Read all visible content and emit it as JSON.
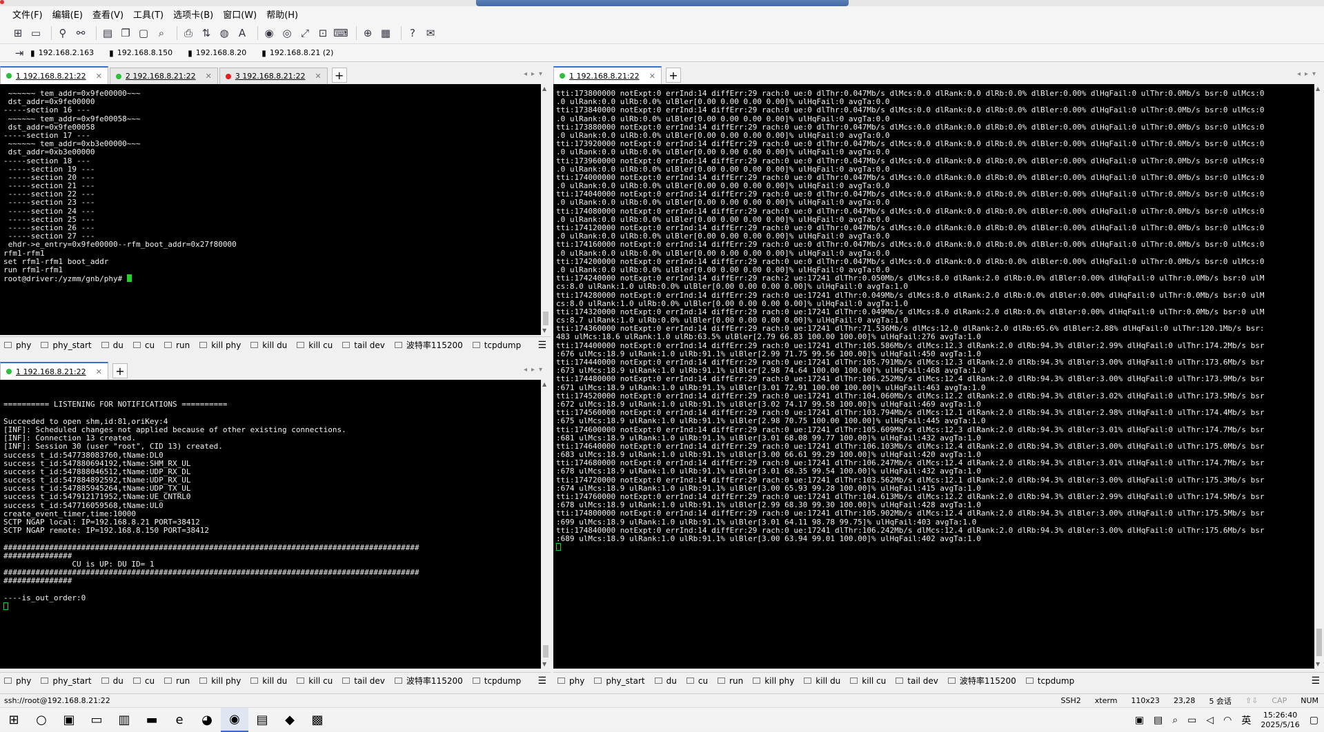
{
  "menu": [
    "文件(F)",
    "编辑(E)",
    "查看(V)",
    "工具(T)",
    "选项卡(B)",
    "窗口(W)",
    "帮助(H)"
  ],
  "bookmarks": [
    "192.168.2.163",
    "192.168.8.150",
    "192.168.8.20",
    "192.168.8.21 (2)"
  ],
  "panes": {
    "top_left": {
      "tabs": [
        {
          "label": "1 192.168.8.21:22",
          "status": "#2bbf3a",
          "active": true
        },
        {
          "label": "2 192.168.8.21:22",
          "status": "#2bbf3a",
          "active": false
        },
        {
          "label": "3 192.168.8.21:22",
          "status": "#e02020",
          "active": false
        }
      ],
      "lines": [
        " ~~~~~~ tem_addr=0x9fe00000~~~",
        " dst_addr=0x9fe00000",
        "-----section 16 ---",
        " ~~~~~~ tem_addr=0x9fe00058~~~",
        " dst_addr=0x9fe00058",
        "-----section 17 ---",
        " ~~~~~~ tem_addr=0xb3e00000~~~",
        " dst_addr=0xb3e00000",
        "-----section 18 ---",
        " -----section 19 ---",
        " -----section 20 ---",
        " -----section 21 ---",
        " -----section 22 ---",
        " -----section 23 ---",
        " -----section 24 ---",
        " -----section 25 ---",
        " -----section 26 ---",
        " -----section 27 ---",
        " ehdr->e_entry=0x9fe00000--rfm_boot_addr=0x27f80000",
        "rfm1-rfm1",
        "set rfm1-rfm1 boot_addr",
        "run rfm1-rfm1"
      ],
      "prompt": "root@driver:/yzmm/gnb/phy# "
    },
    "bottom_left": {
      "tabs": [
        {
          "label": "1 192.168.8.21:22",
          "status": "#2bbf3a",
          "active": true
        }
      ],
      "lines": [
        "",
        "",
        "========== LISTENING FOR NOTIFICATIONS ==========",
        "",
        "Succeeded to open shm,id:81,oriKey:4",
        "[INF]: Scheduled changes not applied because of other existing connections.",
        "[INF]: Connection 13 created.",
        "[INF]: Session 30 (user \"root\", CID 13) created.",
        "success t_id:547738083760,tName:DL0",
        "success t_id:547880694192,tName:SHM_RX_UL",
        "success t_id:547888046512,tName:UDP_RX_DL",
        "success t_id:547884892592,tName:UDP_RX_UL",
        "success t_id:547885945264,tName:UDP_TX_UL",
        "success t_id:547912171952,tName:UE_CNTRL0",
        "success t_id:547716059568,tName:UL0",
        "create_event_timer,time:10000",
        "SCTP NGAP local: IP=192.168.8.21 PORT=38412",
        "SCTP NGAP remote: IP=192.168.8.150 PORT=38412",
        "",
        "###########################################################################################",
        "###############",
        "               CU is UP: DU ID= 1",
        "###########################################################################################",
        "###############",
        "",
        "----is_out_order:0"
      ]
    },
    "right": {
      "tabs": [
        {
          "label": "1 192.168.8.21:22",
          "status": "#2bbf3a",
          "active": true
        }
      ],
      "lines": [
        "tti:173800000 notExpt:0 errInd:14 diffErr:29 rach:0 ue:0 dlThr:0.047Mb/s dlMcs:0.0 dlRank:0.0 dlRb:0.0% dlBler:0.00% dlHqFail:0 ulThr:0.0Mb/s bsr:0 ulMcs:0",
        ".0 ulRank:0.0 ulRb:0.0% ulBler[0.00 0.00 0.00 0.00]% ulHqFail:0 avgTa:0.0",
        "tti:173840000 notExpt:0 errInd:14 diffErr:29 rach:0 ue:0 dlThr:0.047Mb/s dlMcs:0.0 dlRank:0.0 dlRb:0.0% dlBler:0.00% dlHqFail:0 ulThr:0.0Mb/s bsr:0 ulMcs:0",
        ".0 ulRank:0.0 ulRb:0.0% ulBler[0.00 0.00 0.00 0.00]% ulHqFail:0 avgTa:0.0",
        "tti:173880000 notExpt:0 errInd:14 diffErr:29 rach:0 ue:0 dlThr:0.047Mb/s dlMcs:0.0 dlRank:0.0 dlRb:0.0% dlBler:0.00% dlHqFail:0 ulThr:0.0Mb/s bsr:0 ulMcs:0",
        ".0 ulRank:0.0 ulRb:0.0% ulBler[0.00 0.00 0.00 0.00]% ulHqFail:0 avgTa:0.0",
        "tti:173920000 notExpt:0 errInd:14 diffErr:29 rach:0 ue:0 dlThr:0.047Mb/s dlMcs:0.0 dlRank:0.0 dlRb:0.0% dlBler:0.00% dlHqFail:0 ulThr:0.0Mb/s bsr:0 ulMcs:0",
        ".0 ulRank:0.0 ulRb:0.0% ulBler[0.00 0.00 0.00 0.00]% ulHqFail:0 avgTa:0.0",
        "tti:173960000 notExpt:0 errInd:14 diffErr:29 rach:0 ue:0 dlThr:0.047Mb/s dlMcs:0.0 dlRank:0.0 dlRb:0.0% dlBler:0.00% dlHqFail:0 ulThr:0.0Mb/s bsr:0 ulMcs:0",
        ".0 ulRank:0.0 ulRb:0.0% ulBler[0.00 0.00 0.00 0.00]% ulHqFail:0 avgTa:0.0",
        "tti:174000000 notExpt:0 errInd:14 diffErr:29 rach:0 ue:0 dlThr:0.047Mb/s dlMcs:0.0 dlRank:0.0 dlRb:0.0% dlBler:0.00% dlHqFail:0 ulThr:0.0Mb/s bsr:0 ulMcs:0",
        ".0 ulRank:0.0 ulRb:0.0% ulBler[0.00 0.00 0.00 0.00]% ulHqFail:0 avgTa:0.0",
        "tti:174040000 notExpt:0 errInd:14 diffErr:29 rach:0 ue:0 dlThr:0.047Mb/s dlMcs:0.0 dlRank:0.0 dlRb:0.0% dlBler:0.00% dlHqFail:0 ulThr:0.0Mb/s bsr:0 ulMcs:0",
        ".0 ulRank:0.0 ulRb:0.0% ulBler[0.00 0.00 0.00 0.00]% ulHqFail:0 avgTa:0.0",
        "tti:174080000 notExpt:0 errInd:14 diffErr:29 rach:0 ue:0 dlThr:0.047Mb/s dlMcs:0.0 dlRank:0.0 dlRb:0.0% dlBler:0.00% dlHqFail:0 ulThr:0.0Mb/s bsr:0 ulMcs:0",
        ".0 ulRank:0.0 ulRb:0.0% ulBler[0.00 0.00 0.00 0.00]% ulHqFail:0 avgTa:0.0",
        "tti:174120000 notExpt:0 errInd:14 diffErr:29 rach:0 ue:0 dlThr:0.047Mb/s dlMcs:0.0 dlRank:0.0 dlRb:0.0% dlBler:0.00% dlHqFail:0 ulThr:0.0Mb/s bsr:0 ulMcs:0",
        ".0 ulRank:0.0 ulRb:0.0% ulBler[0.00 0.00 0.00 0.00]% ulHqFail:0 avgTa:0.0",
        "tti:174160000 notExpt:0 errInd:14 diffErr:29 rach:0 ue:0 dlThr:0.047Mb/s dlMcs:0.0 dlRank:0.0 dlRb:0.0% dlBler:0.00% dlHqFail:0 ulThr:0.0Mb/s bsr:0 ulMcs:0",
        ".0 ulRank:0.0 ulRb:0.0% ulBler[0.00 0.00 0.00 0.00]% ulHqFail:0 avgTa:0.0",
        "tti:174200000 notExpt:0 errInd:14 diffErr:29 rach:0 ue:0 dlThr:0.047Mb/s dlMcs:0.0 dlRank:0.0 dlRb:0.0% dlBler:0.00% dlHqFail:0 ulThr:0.0Mb/s bsr:0 ulMcs:0",
        ".0 ulRank:0.0 ulRb:0.0% ulBler[0.00 0.00 0.00 0.00]% ulHqFail:0 avgTa:0.0",
        "tti:174240000 notExpt:0 errInd:14 diffErr:29 rach:2 ue:17241 dlThr:0.050Mb/s dlMcs:8.0 dlRank:2.0 dlRb:0.0% dlBler:0.00% dlHqFail:0 ulThr:0.0Mb/s bsr:0 ulM",
        "cs:8.0 ulRank:1.0 ulRb:0.0% ulBler[0.00 0.00 0.00 0.00]% ulHqFail:0 avgTa:1.0",
        "tti:174280000 notExpt:0 errInd:14 diffErr:29 rach:0 ue:17241 dlThr:0.049Mb/s dlMcs:8.0 dlRank:2.0 dlRb:0.0% dlBler:0.00% dlHqFail:0 ulThr:0.0Mb/s bsr:0 ulM",
        "cs:8.0 ulRank:1.0 ulRb:0.0% ulBler[0.00 0.00 0.00 0.00]% ulHqFail:0 avgTa:1.0",
        "tti:174320000 notExpt:0 errInd:14 diffErr:29 rach:0 ue:17241 dlThr:0.049Mb/s dlMcs:8.0 dlRank:2.0 dlRb:0.0% dlBler:0.00% dlHqFail:0 ulThr:0.0Mb/s bsr:0 ulM",
        "cs:8.7 ulRank:1.0 ulRb:0.0% ulBler[0.00 0.00 0.00 0.00]% ulHqFail:0 avgTa:1.0",
        "tti:174360000 notExpt:0 errInd:14 diffErr:29 rach:0 ue:17241 dlThr:71.536Mb/s dlMcs:12.0 dlRank:2.0 dlRb:65.6% dlBler:2.88% dlHqFail:0 ulThr:120.1Mb/s bsr:",
        "483 ulMcs:18.6 ulRank:1.0 ulRb:63.5% ulBler[2.79 66.83 100.00 100.00]% ulHqFail:276 avgTa:1.0",
        "tti:174400000 notExpt:0 errInd:14 diffErr:29 rach:0 ue:17241 dlThr:105.586Mb/s dlMcs:12.3 dlRank:2.0 dlRb:94.3% dlBler:2.99% dlHqFail:0 ulThr:174.2Mb/s bsr",
        ":676 ulMcs:18.9 ulRank:1.0 ulRb:91.1% ulBler[2.99 71.75 99.56 100.00]% ulHqFail:450 avgTa:1.0",
        "tti:174440000 notExpt:0 errInd:14 diffErr:29 rach:0 ue:17241 dlThr:105.791Mb/s dlMcs:12.3 dlRank:2.0 dlRb:94.3% dlBler:3.00% dlHqFail:0 ulThr:173.6Mb/s bsr",
        ":673 ulMcs:18.9 ulRank:1.0 ulRb:91.1% ulBler[2.98 74.64 100.00 100.00]% ulHqFail:468 avgTa:1.0",
        "tti:174480000 notExpt:0 errInd:14 diffErr:29 rach:0 ue:17241 dlThr:106.252Mb/s dlMcs:12.4 dlRank:2.0 dlRb:94.3% dlBler:3.00% dlHqFail:0 ulThr:173.9Mb/s bsr",
        ":671 ulMcs:18.9 ulRank:1.0 ulRb:91.1% ulBler[3.01 72.91 100.00 100.00]% ulHqFail:463 avgTa:1.0",
        "tti:174520000 notExpt:0 errInd:14 diffErr:29 rach:0 ue:17241 dlThr:104.060Mb/s dlMcs:12.2 dlRank:2.0 dlRb:94.3% dlBler:3.02% dlHqFail:0 ulThr:173.5Mb/s bsr",
        ":672 ulMcs:18.9 ulRank:1.0 ulRb:91.1% ulBler[3.02 74.17 99.58 100.00]% ulHqFail:469 avgTa:1.0",
        "tti:174560000 notExpt:0 errInd:14 diffErr:29 rach:0 ue:17241 dlThr:103.794Mb/s dlMcs:12.1 dlRank:2.0 dlRb:94.3% dlBler:2.98% dlHqFail:0 ulThr:174.4Mb/s bsr",
        ":675 ulMcs:18.9 ulRank:1.0 ulRb:91.1% ulBler[2.98 70.75 100.00 100.00]% ulHqFail:445 avgTa:1.0",
        "tti:174600000 notExpt:0 errInd:14 diffErr:29 rach:0 ue:17241 dlThr:105.609Mb/s dlMcs:12.3 dlRank:2.0 dlRb:94.3% dlBler:3.01% dlHqFail:0 ulThr:174.7Mb/s bsr",
        ":681 ulMcs:18.9 ulRank:1.0 ulRb:91.1% ulBler[3.01 68.08 99.77 100.00]% ulHqFail:432 avgTa:1.0",
        "tti:174640000 notExpt:0 errInd:14 diffErr:29 rach:0 ue:17241 dlThr:106.103Mb/s dlMcs:12.4 dlRank:2.0 dlRb:94.3% dlBler:3.00% dlHqFail:0 ulThr:175.0Mb/s bsr",
        ":683 ulMcs:18.9 ulRank:1.0 ulRb:91.1% ulBler[3.00 66.61 99.29 100.00]% ulHqFail:420 avgTa:1.0",
        "tti:174680000 notExpt:0 errInd:14 diffErr:29 rach:0 ue:17241 dlThr:106.247Mb/s dlMcs:12.4 dlRank:2.0 dlRb:94.3% dlBler:3.01% dlHqFail:0 ulThr:174.7Mb/s bsr",
        ":678 ulMcs:18.9 ulRank:1.0 ulRb:91.1% ulBler[3.01 68.35 99.54 100.00]% ulHqFail:432 avgTa:1.0",
        "tti:174720000 notExpt:0 errInd:14 diffErr:29 rach:0 ue:17241 dlThr:103.562Mb/s dlMcs:12.1 dlRank:2.0 dlRb:94.3% dlBler:3.00% dlHqFail:0 ulThr:175.3Mb/s bsr",
        ":674 ulMcs:18.9 ulRank:1.0 ulRb:91.1% ulBler[3.00 65.93 99.28 100.00]% ulHqFail:415 avgTa:1.0",
        "tti:174760000 notExpt:0 errInd:14 diffErr:29 rach:0 ue:17241 dlThr:104.613Mb/s dlMcs:12.2 dlRank:2.0 dlRb:94.3% dlBler:2.99% dlHqFail:0 ulThr:174.5Mb/s bsr",
        ":678 ulMcs:18.9 ulRank:1.0 ulRb:91.1% ulBler[2.99 68.30 99.30 100.00]% ulHqFail:428 avgTa:1.0",
        "tti:174800000 notExpt:0 errInd:14 diffErr:29 rach:0 ue:17241 dlThr:105.902Mb/s dlMcs:12.4 dlRank:2.0 dlRb:94.3% dlBler:3.00% dlHqFail:0 ulThr:175.5Mb/s bsr",
        ":699 ulMcs:18.9 ulRank:1.0 ulRb:91.1% ulBler[3.01 64.11 98.78 99.75]% ulHqFail:403 avgTa:1.0",
        "tti:174840000 notExpt:0 errInd:14 diffErr:29 rach:0 ue:17241 dlThr:106.242Mb/s dlMcs:12.4 dlRank:2.0 dlRb:94.3% dlBler:3.00% dlHqFail:0 ulThr:175.6Mb/s bsr",
        ":689 ulMcs:18.9 ulRank:1.0 ulRb:91.1% ulBler[3.00 63.94 99.01 100.00]% ulHqFail:402 avgTa:1.0"
      ]
    }
  },
  "commands": [
    "phy",
    "phy_start",
    "du",
    "cu",
    "run",
    "kill phy",
    "kill du",
    "kill cu",
    "tail dev",
    "波特率115200",
    "tcpdump"
  ],
  "status": {
    "path": "ssh://root@192.168.8.21:22",
    "protocol": "SSH2",
    "term": "xterm",
    "size": "110x23",
    "pos": "23,28",
    "sessions": "5 会话",
    "cap": "CAP",
    "num": "NUM"
  },
  "clock": {
    "time": "15:26:40",
    "date": "2025/5/16"
  },
  "ime": "英"
}
